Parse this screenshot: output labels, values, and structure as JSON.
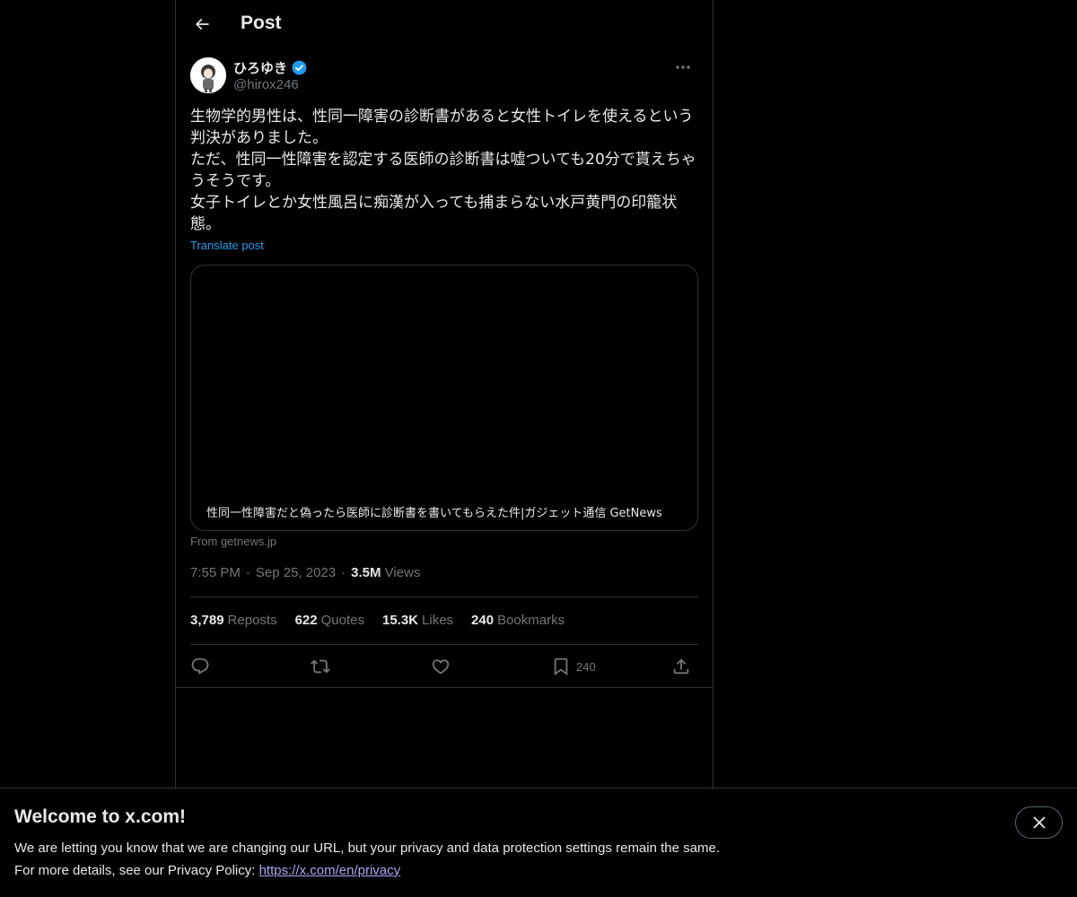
{
  "header": {
    "title": "Post"
  },
  "author": {
    "display_name": "ひろゆき",
    "handle": "@hirox246",
    "verified": true,
    "verified_color": "#1d9bf0"
  },
  "post": {
    "text": "生物学的男性は、性同一障害の診断書があると女性トイレを使えるという\n判決がありました。\nただ、性同一性障害を認定する医師の診断書は嘘ついても20分で貰えちゃ\nうそうです。\n女子トイレとか女性風呂に痴漢が入っても捕まらない水戸黄門の印籠状\n態。",
    "translate_label": "Translate post"
  },
  "card": {
    "title": "性同一性障害だと偽ったら医師に診断書を書いてもらえた件|ガジェット通信 GetNews",
    "source": "From getnews.jp"
  },
  "meta": {
    "time": "7:55 PM",
    "date": "Sep 25, 2023",
    "views_count": "3.5M",
    "views_label": "Views",
    "separator": "·"
  },
  "stats": [
    {
      "count": "3,789",
      "label": "Reposts"
    },
    {
      "count": "622",
      "label": "Quotes"
    },
    {
      "count": "15.3K",
      "label": "Likes"
    },
    {
      "count": "240",
      "label": "Bookmarks"
    }
  ],
  "actions": {
    "reply_icon": "reply-icon",
    "repost_icon": "repost-icon",
    "like_icon": "heart-icon",
    "bookmark_icon": "bookmark-icon",
    "bookmark_count": "240",
    "share_icon": "share-icon"
  },
  "banner": {
    "title": "Welcome to x.com!",
    "line1": "We are letting you know that we are changing our URL, but your privacy and data protection settings remain the same.",
    "line2_prefix": "For more details, see our Privacy Policy: ",
    "link": "https://x.com/en/privacy"
  },
  "colors": {
    "background": "#000000",
    "text": "#e7e9ea",
    "muted": "#71767b",
    "accent": "#1d9bf0",
    "border": "#2f3336"
  }
}
